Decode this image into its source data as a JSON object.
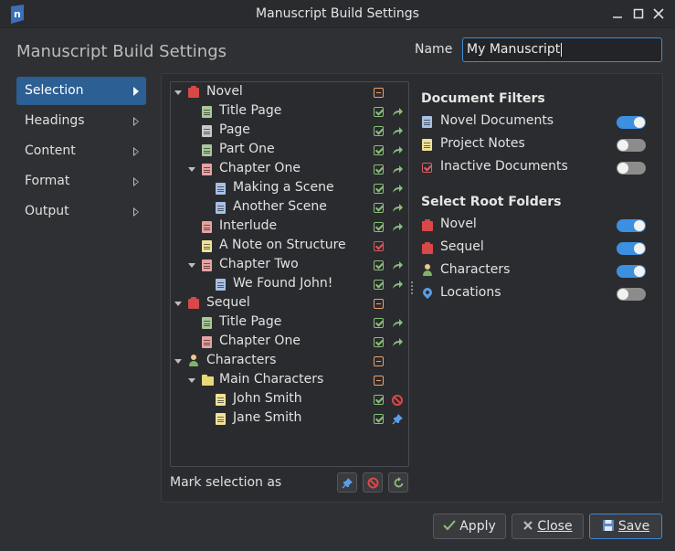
{
  "window": {
    "title": "Manuscript Build Settings",
    "app_icon_letter": "n"
  },
  "header": {
    "title": "Manuscript Build Settings",
    "name_label": "Name",
    "name_value": "My Manuscript"
  },
  "sidebar": {
    "items": [
      {
        "label": "Selection",
        "active": true
      },
      {
        "label": "Headings",
        "active": false
      },
      {
        "label": "Content",
        "active": false
      },
      {
        "label": "Format",
        "active": false
      },
      {
        "label": "Output",
        "active": false
      }
    ]
  },
  "tree": {
    "rows": [
      {
        "label": "Novel",
        "icon": "novel-root-icon",
        "status": "partial",
        "action": ""
      },
      {
        "label": "Title Page",
        "icon": "title-page-icon",
        "status": "included",
        "action": "include-arrow"
      },
      {
        "label": "Page",
        "icon": "page-icon",
        "status": "included",
        "action": "include-arrow"
      },
      {
        "label": "Part One",
        "icon": "partition-icon",
        "status": "included",
        "action": "include-arrow"
      },
      {
        "label": "Chapter One",
        "icon": "chapter-icon",
        "status": "included",
        "action": "include-arrow"
      },
      {
        "label": "Making a Scene",
        "icon": "scene-icon",
        "status": "included",
        "action": "include-arrow"
      },
      {
        "label": "Another Scene",
        "icon": "scene-icon",
        "status": "included",
        "action": "include-arrow"
      },
      {
        "label": "Interlude",
        "icon": "chapter-icon",
        "status": "included",
        "action": "include-arrow"
      },
      {
        "label": "A Note on Structure",
        "icon": "note-icon",
        "status": "inactive",
        "action": ""
      },
      {
        "label": "Chapter Two",
        "icon": "chapter-icon",
        "status": "included",
        "action": "include-arrow"
      },
      {
        "label": "We Found John!",
        "icon": "scene-icon",
        "status": "included",
        "action": "include-arrow"
      },
      {
        "label": "Sequel",
        "icon": "novel-root-icon",
        "status": "partial",
        "action": ""
      },
      {
        "label": "Title Page",
        "icon": "title-page-icon",
        "status": "included",
        "action": "include-arrow"
      },
      {
        "label": "Chapter One",
        "icon": "chapter-icon",
        "status": "included",
        "action": "include-arrow"
      },
      {
        "label": "Characters",
        "icon": "characters-root-icon",
        "status": "partial",
        "action": ""
      },
      {
        "label": "Main Characters",
        "icon": "folder-icon",
        "status": "partial",
        "action": ""
      },
      {
        "label": "John Smith",
        "icon": "note-icon",
        "status": "included",
        "action": "excluded"
      },
      {
        "label": "Jane Smith",
        "icon": "note-icon",
        "status": "included",
        "action": "pinned"
      }
    ]
  },
  "mark_selection": {
    "label": "Mark selection as"
  },
  "document_filters": {
    "title": "Document Filters",
    "items": [
      {
        "label": "Novel Documents",
        "on": true
      },
      {
        "label": "Project Notes",
        "on": false
      },
      {
        "label": "Inactive Documents",
        "on": false
      }
    ]
  },
  "root_folders": {
    "title": "Select Root Folders",
    "items": [
      {
        "label": "Novel",
        "on": true
      },
      {
        "label": "Sequel",
        "on": true
      },
      {
        "label": "Characters",
        "on": true
      },
      {
        "label": "Locations",
        "on": false
      }
    ]
  },
  "buttons": {
    "apply": "Apply",
    "close": "Close",
    "save": "Save"
  },
  "colors": {
    "accent": "#3d8fe0",
    "sidebar_active": "#2c5f93",
    "background": "#2f3033"
  }
}
